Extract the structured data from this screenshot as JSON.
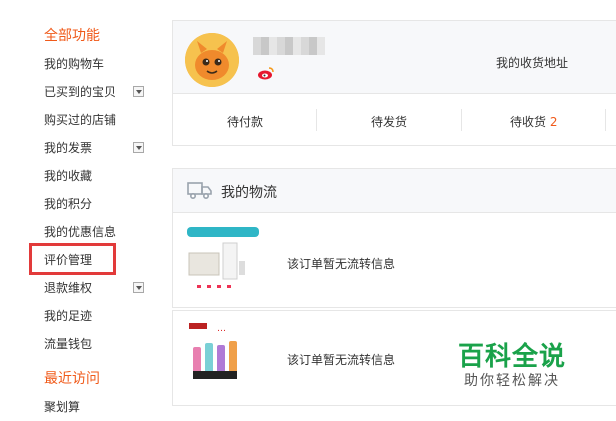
{
  "sidebar": {
    "section_all": "全部功能",
    "items": [
      {
        "label": "我的购物车",
        "expandable": false
      },
      {
        "label": "已买到的宝贝",
        "expandable": true
      },
      {
        "label": "购买过的店铺",
        "expandable": false
      },
      {
        "label": "我的发票",
        "expandable": true
      },
      {
        "label": "我的收藏",
        "expandable": false
      },
      {
        "label": "我的积分",
        "expandable": false
      },
      {
        "label": "我的优惠信息",
        "expandable": false
      },
      {
        "label": "评价管理",
        "expandable": false,
        "highlighted": true
      },
      {
        "label": "退款维权",
        "expandable": true
      },
      {
        "label": "我的足迹",
        "expandable": false
      },
      {
        "label": "流量钱包",
        "expandable": false
      }
    ],
    "section_recent": "最近访问",
    "recent_items": [
      {
        "label": "聚划算"
      }
    ]
  },
  "profile": {
    "address_link": "我的收货地址",
    "order_tabs": [
      {
        "label": "待付款",
        "count": ""
      },
      {
        "label": "待发货",
        "count": ""
      },
      {
        "label": "待收货",
        "count": "2"
      }
    ]
  },
  "logistics": {
    "title": "我的物流",
    "rows": [
      {
        "message": "该订单暂无流转信息",
        "thumb": "white-powerbank-product"
      },
      {
        "message": "该订单暂无流转信息",
        "thumb": "colorful-lipstick-product"
      }
    ]
  },
  "watermark": {
    "title": "百科全说",
    "subtitle": "助你轻松解决"
  },
  "colors": {
    "accent": "#f05a1a",
    "highlight_border": "#e23a3a",
    "watermark_green": "#1aa24a"
  }
}
